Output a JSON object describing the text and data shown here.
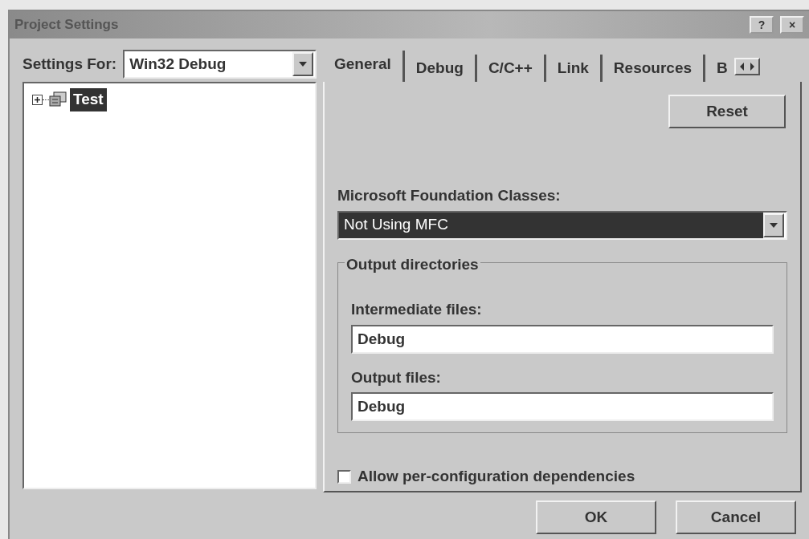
{
  "window": {
    "title": "Project Settings",
    "help_button": "?",
    "close_button": "×"
  },
  "settings_for": {
    "label": "Settings For:",
    "value": "Win32 Debug"
  },
  "tree": [
    {
      "label": "Test",
      "expanded": false,
      "selected": true
    }
  ],
  "tabs": [
    {
      "label": "General",
      "selected": true
    },
    {
      "label": "Debug",
      "selected": false
    },
    {
      "label": "C/C++",
      "selected": false
    },
    {
      "label": "Link",
      "selected": false
    },
    {
      "label": "Resources",
      "selected": false
    },
    {
      "label": "B",
      "selected": false
    }
  ],
  "reset_button": "Reset",
  "mfc": {
    "label": "Microsoft Foundation Classes:",
    "value": "Not Using MFC",
    "focused": true
  },
  "output_directories": {
    "title": "Output directories",
    "fields": [
      {
        "label": "Intermediate files:",
        "value": "Debug"
      },
      {
        "label": "Output files:",
        "value": "Debug"
      }
    ]
  },
  "per_config_dependencies": {
    "label": "Allow per-configuration dependencies",
    "checked": false
  },
  "buttons": [
    "OK",
    "Cancel"
  ]
}
